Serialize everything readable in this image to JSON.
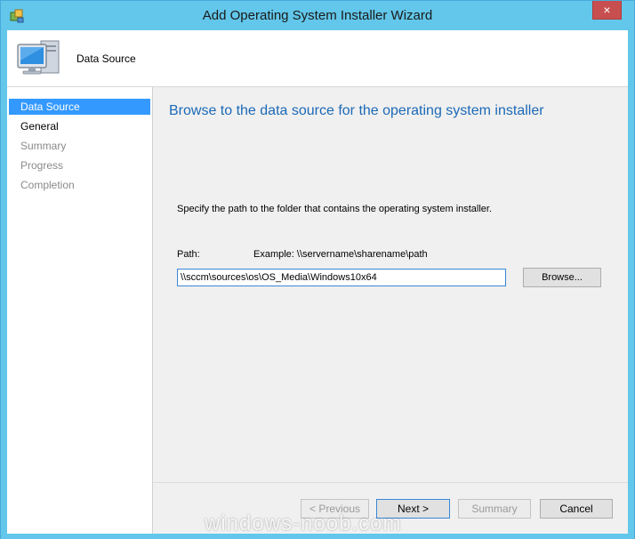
{
  "window": {
    "title": "Add Operating System Installer Wizard",
    "close_label": "×"
  },
  "header": {
    "title": "Data Source"
  },
  "nav": {
    "items": [
      {
        "label": "Data Source"
      },
      {
        "label": "General"
      },
      {
        "label": "Summary"
      },
      {
        "label": "Progress"
      },
      {
        "label": "Completion"
      }
    ]
  },
  "main": {
    "heading": "Browse to the data source for the operating system installer",
    "instruction": "Specify the path to the folder that contains the operating system installer.",
    "path_label": "Path:",
    "example_label": "Example: \\\\servername\\sharename\\path",
    "path_value": "\\\\sccm\\sources\\os\\OS_Media\\Windows10x64",
    "browse_label": "Browse..."
  },
  "footer": {
    "previous_label": "< Previous",
    "next_label": "Next >",
    "summary_label": "Summary",
    "cancel_label": "Cancel"
  },
  "watermark": "windows-noob.com",
  "colors": {
    "title_bar": "#62c7ea",
    "heading": "#1c69b6",
    "selection": "#3399ff",
    "close_button": "#c74f4f"
  },
  "icons": {
    "app": "wizard-app-icon",
    "header": "computer-monitor-icon",
    "close": "close-icon"
  }
}
